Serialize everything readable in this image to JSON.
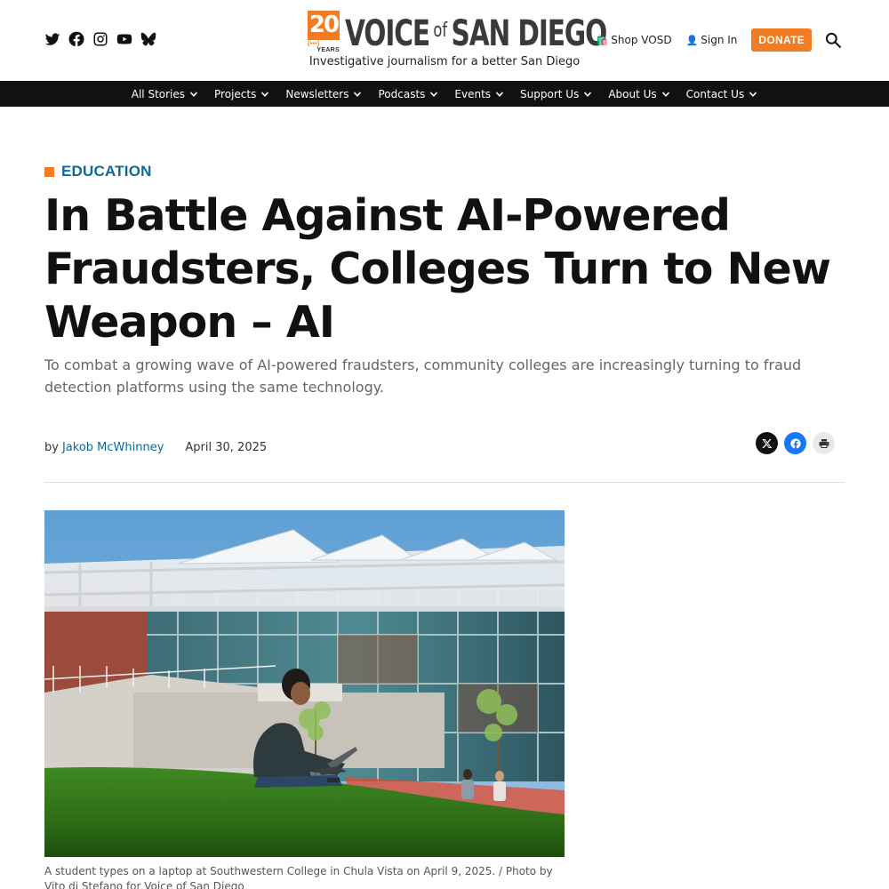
{
  "header": {
    "social": [
      {
        "icon": "twitter-icon"
      },
      {
        "icon": "facebook-icon"
      },
      {
        "icon": "instagram-icon"
      },
      {
        "icon": "youtube-icon"
      },
      {
        "icon": "bluesky-icon"
      }
    ],
    "logo": {
      "badge_number": "20",
      "badge_years": "YEARS",
      "name_part1": "VOICE",
      "name_of": "of",
      "name_part2": "SAN DIEGO"
    },
    "tagline": "Investigative journalism for a better San Diego",
    "shop_label": "Shop VOSD",
    "shop_icon": "🛍️",
    "signin_label": "Sign In",
    "signin_icon": "👤",
    "donate_label": "DONATE",
    "accent_color": "#f17c22"
  },
  "nav": {
    "items": [
      {
        "label": "All Stories"
      },
      {
        "label": "Projects"
      },
      {
        "label": "Newsletters"
      },
      {
        "label": "Podcasts"
      },
      {
        "label": "Events"
      },
      {
        "label": "Support Us"
      },
      {
        "label": "About Us"
      },
      {
        "label": "Contact Us"
      }
    ]
  },
  "article": {
    "category": "EDUCATION",
    "title": "In Battle Against AI-Powered Fraudsters, Colleges Turn to New Weapon – AI",
    "dek": "To combat a growing wave of AI-powered fraudsters, community colleges are increasingly turning to fraud detection platforms using the same technology.",
    "byline_prefix": "by",
    "author": "Jakob McWhinney",
    "date": "April 30, 2025",
    "share": [
      "x-icon",
      "facebook-icon",
      "print-icon"
    ],
    "caption": "A student types on a laptop at Southwestern College in Chula Vista on April 9, 2025. / Photo by Vito di Stefano for Voice of San Diego",
    "link_color": "#0c6a9a"
  }
}
